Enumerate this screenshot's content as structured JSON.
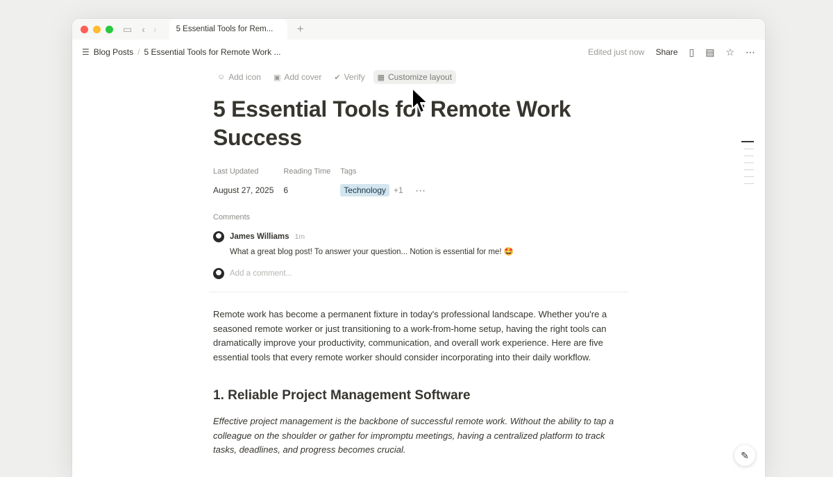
{
  "browser": {
    "tab_title": "5 Essential Tools for Rem...",
    "new_tab_symbol": "+"
  },
  "topbar": {
    "breadcrumb_root": "Blog Posts",
    "breadcrumb_page": "5 Essential Tools for Remote Work ...",
    "edited": "Edited just now",
    "share": "Share"
  },
  "page_actions": {
    "add_icon": "Add icon",
    "add_cover": "Add cover",
    "verify": "Verify",
    "customize_layout": "Customize layout"
  },
  "page": {
    "title": "5 Essential Tools for Remote Work Success",
    "properties": {
      "last_updated_label": "Last Updated",
      "last_updated_value": "August 27, 2025",
      "reading_time_label": "Reading Time",
      "reading_time_value": "6",
      "tags_label": "Tags",
      "tag_value": "Technology",
      "tag_more": "+1",
      "more": "···"
    },
    "comments": {
      "label": "Comments",
      "author": "James Williams",
      "time": "1m",
      "text": "What a great blog post! To answer your question... Notion is essential for me! 🤩",
      "add_placeholder": "Add a comment..."
    },
    "intro": "Remote work has become a permanent fixture in today's professional landscape. Whether you're a seasoned remote worker or just transitioning to a work-from-home setup, having the right tools can dramatically improve your productivity, communication, and overall work experience. Here are five essential tools that every remote worker should consider incorporating into their daily workflow.",
    "heading1": "1. Reliable Project Management Software",
    "paragraph1": "Effective project management is the backbone of successful remote work. Without the ability to tap a colleague on the shoulder or gather for impromptu meetings, having a centralized platform to track tasks, deadlines, and progress becomes crucial."
  },
  "colors": {
    "tag_bg": "#d3e5ef",
    "text": "#37352f",
    "muted": "#9b9b97"
  }
}
